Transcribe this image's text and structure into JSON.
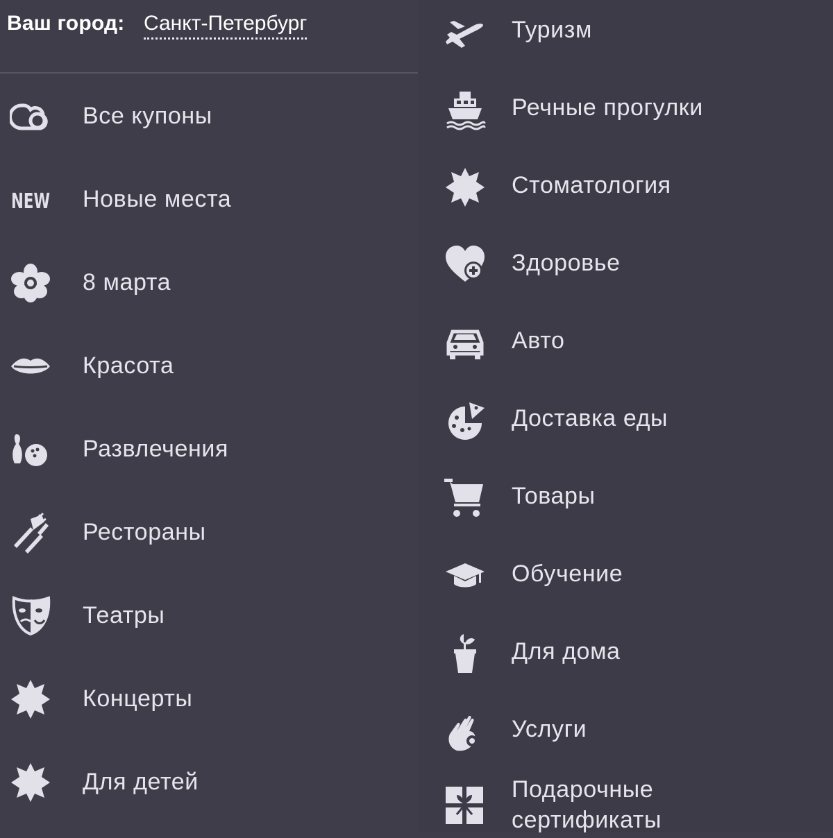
{
  "city": {
    "label": "Ваш город:",
    "value": "Санкт-Петербург"
  },
  "left_menu": [
    {
      "label": "Все купоны",
      "icon": "coupons-icon"
    },
    {
      "label": "Новые места",
      "icon": "new-icon",
      "icon_text": "NEW"
    },
    {
      "label": "8 марта",
      "icon": "flower-icon"
    },
    {
      "label": "Красота",
      "icon": "lips-icon"
    },
    {
      "label": "Развлечения",
      "icon": "bowling-icon"
    },
    {
      "label": "Рестораны",
      "icon": "cutlery-icon"
    },
    {
      "label": "Театры",
      "icon": "theater-mask-icon"
    },
    {
      "label": "Концерты",
      "icon": "star-burst-icon"
    },
    {
      "label": "Для детей",
      "icon": "star-burst-icon"
    }
  ],
  "right_menu": [
    {
      "label": "Туризм",
      "icon": "airplane-icon"
    },
    {
      "label": "Речные прогулки",
      "icon": "ship-icon"
    },
    {
      "label": "Стоматология",
      "icon": "star-burst-icon"
    },
    {
      "label": "Здоровье",
      "icon": "heart-plus-icon"
    },
    {
      "label": "Авто",
      "icon": "car-icon"
    },
    {
      "label": "Доставка еды",
      "icon": "pizza-icon"
    },
    {
      "label": "Товары",
      "icon": "cart-icon"
    },
    {
      "label": "Обучение",
      "icon": "graduation-cap-icon"
    },
    {
      "label": "Для дома",
      "icon": "plant-pot-icon"
    },
    {
      "label": "Услуги",
      "icon": "hand-ok-icon"
    },
    {
      "label": "Подарочные сертификаты",
      "icon": "gift-icon"
    }
  ],
  "colors": {
    "background_left": "#3e3d49",
    "background_right": "#3c3b47",
    "icon": "#e2e1e9",
    "text": "#e6e5ec"
  }
}
